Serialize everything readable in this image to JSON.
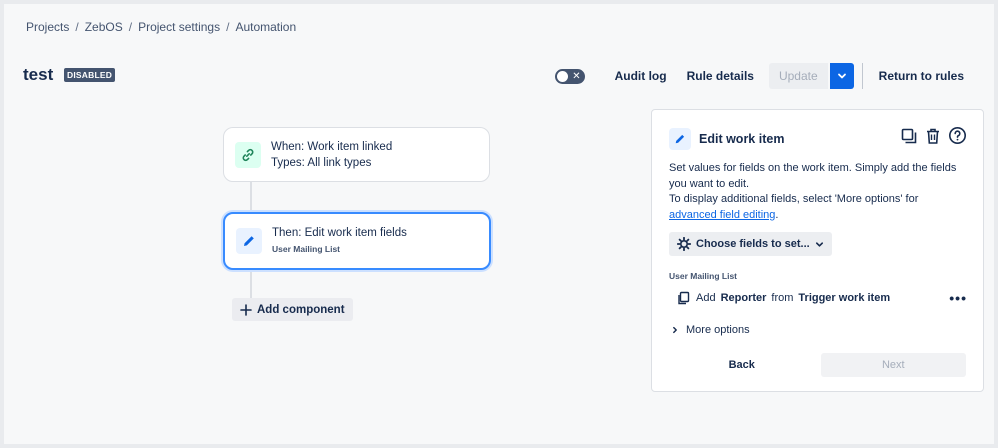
{
  "breadcrumb": {
    "items": [
      "Projects",
      "ZebOS",
      "Project settings",
      "Automation"
    ],
    "separator": "/"
  },
  "rule": {
    "name": "test",
    "status": "DISABLED",
    "enabled": false
  },
  "toolbar": {
    "audit_log": "Audit log",
    "rule_details": "Rule details",
    "update": "Update",
    "return": "Return to rules"
  },
  "flow": {
    "trigger": {
      "title": "When: Work item linked",
      "subtitle": "Types: All link types",
      "icon": "link-icon"
    },
    "action": {
      "title": "Then: Edit work item fields",
      "subtitle": "User Mailing List",
      "icon": "pencil-icon"
    },
    "add_component": "Add component"
  },
  "panel": {
    "title": "Edit work item",
    "description_1": "Set values for fields on the work item. Simply add the fields you want to edit.",
    "description_2": "To display additional fields, select 'More options' for",
    "description_link": "advanced field editing",
    "description_end": ".",
    "choose_fields": "Choose fields to set...",
    "field_label": "User Mailing List",
    "field_row": {
      "prefix": "Add",
      "field": "Reporter",
      "middle": "from",
      "source": "Trigger work item"
    },
    "more_options": "More options",
    "back": "Back",
    "next": "Next"
  },
  "colors": {
    "accent": "#0c66e4",
    "selected_border": "#388bff",
    "trigger_icon_bg": "#dcfff1",
    "action_icon_bg": "#e9f2ff",
    "lozenge_bg": "#44546f"
  }
}
